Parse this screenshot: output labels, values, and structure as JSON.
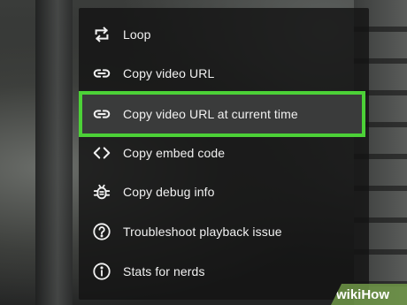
{
  "context_menu": {
    "items": [
      {
        "label": "Loop",
        "icon": "loop-icon"
      },
      {
        "label": "Copy video URL",
        "icon": "link-icon"
      },
      {
        "label": "Copy video URL at current time",
        "icon": "link-icon",
        "highlighted": true
      },
      {
        "label": "Copy embed code",
        "icon": "code-icon"
      },
      {
        "label": "Copy debug info",
        "icon": "bug-icon"
      },
      {
        "label": "Troubleshoot playback issue",
        "icon": "help-circle-icon"
      },
      {
        "label": "Stats for nerds",
        "icon": "info-circle-icon"
      }
    ]
  },
  "watermark": {
    "text": "wikiHow"
  },
  "colors": {
    "menu_background": "#141414",
    "menu_text": "#f1f1f1",
    "highlight_outline": "#4cd137",
    "watermark_green": "#6e9646"
  }
}
